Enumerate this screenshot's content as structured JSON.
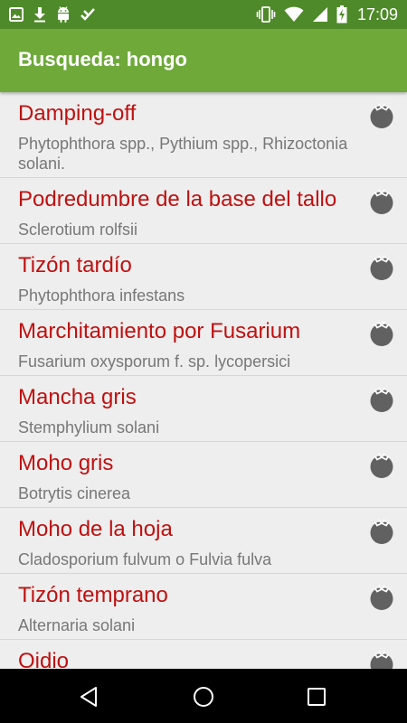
{
  "status_bar": {
    "time": "17:09",
    "left_icons": [
      "image-icon",
      "download-icon",
      "android-icon",
      "check-flag-icon"
    ],
    "right_icons": [
      "vibrate-icon",
      "wifi-icon",
      "signal-icon",
      "battery-icon"
    ]
  },
  "app_bar": {
    "title": "Busqueda: hongo",
    "color": "#6ea93a"
  },
  "results": [
    {
      "name": "Damping-off",
      "pathogen": "Phytophthora spp., Pythium spp., Rhizoctonia solani.",
      "icon": "tomato-icon"
    },
    {
      "name": "Podredumbre de la base del tallo",
      "pathogen": "Sclerotium rolfsii",
      "icon": "tomato-icon"
    },
    {
      "name": "Tizón tardío",
      "pathogen": "Phytophthora infestans",
      "icon": "tomato-icon"
    },
    {
      "name": "Marchitamiento por Fusarium",
      "pathogen": "Fusarium oxysporum f. sp. lycopersici",
      "icon": "tomato-icon"
    },
    {
      "name": "Mancha gris",
      "pathogen": "Stemphylium solani",
      "icon": "tomato-icon"
    },
    {
      "name": "Moho gris",
      "pathogen": "Botrytis cinerea",
      "icon": "tomato-icon"
    },
    {
      "name": "Moho de la hoja",
      "pathogen": "Cladosporium fulvum o Fulvia fulva",
      "icon": "tomato-icon"
    },
    {
      "name": "Tizón temprano",
      "pathogen": "Alternaria solani",
      "icon": "tomato-icon"
    },
    {
      "name": "Oidio",
      "pathogen": "",
      "icon": "tomato-icon"
    }
  ],
  "nav_bar": {
    "buttons": [
      "back-icon",
      "home-icon",
      "recents-icon"
    ]
  },
  "colors": {
    "title_red": "#c01010",
    "subtitle_gray": "#777777",
    "status_green": "#4f8a2a"
  }
}
